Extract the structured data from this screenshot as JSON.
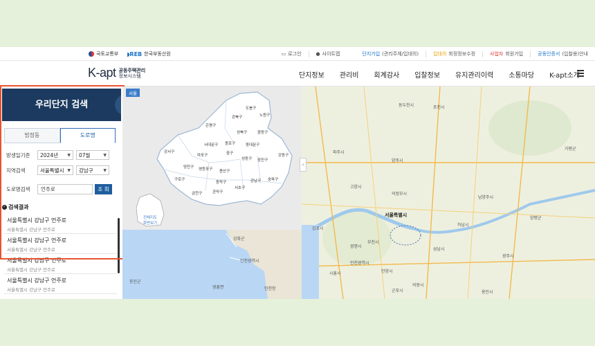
{
  "util_bar": {
    "org1": "국토교통부",
    "org2": "한국부동산원",
    "login": "로그인",
    "sitemap": "사이트맵",
    "link_complex_join": "단지가입",
    "link_complex_join_note": "(관리주체/입대의)",
    "link_resident": "입대의",
    "link_resident_note": "회정정보수정",
    "link_business": "사업자",
    "link_business_note": "회원가입",
    "link_cert": "공동인증서",
    "link_cert_note": "(입찰용)안내"
  },
  "nav": {
    "brand_k": "K-apt",
    "brand_sub1": "공동주택관리",
    "brand_sub2": "정보시스템",
    "items": [
      "단지정보",
      "관리비",
      "회계감사",
      "입찰정보",
      "유지관리이력",
      "소통마당",
      "K-apt소개"
    ]
  },
  "panel": {
    "title": "우리단지 검색",
    "tab_legal": "법정동",
    "tab_road": "도로명",
    "label_year": "방생일기준",
    "year": "2024년",
    "month": "07월",
    "label_region": "지역검색",
    "city": "서울특별시",
    "district": "강남구",
    "label_road": "도로명검색",
    "road_value": "언주로",
    "search_btn": "조 회",
    "results_title": "검색결과",
    "results": [
      {
        "addr": "서울특별시 강남구 언주로",
        "sub": "서울특별시 강남구 언주로"
      },
      {
        "addr": "서울특별시 강남구 언주로",
        "sub": "서울특별시 강남구 언주로"
      },
      {
        "addr": "서울특별시 강남구 언주로",
        "sub": "서울특별시 강남구 언주로"
      },
      {
        "addr": "서울특별시 강남구 언주로",
        "sub": "서울특별시 강남구 언주로"
      }
    ]
  },
  "seoul_map": {
    "tag": "서울",
    "districts": [
      "도봉구",
      "노원구",
      "강북구",
      "은평구",
      "성북구",
      "중랑구",
      "종로구",
      "동대문구",
      "서대문구",
      "마포구",
      "중구",
      "성동구",
      "광진구",
      "강동구",
      "강서구",
      "양천구",
      "영등포구",
      "용산구",
      "동작구",
      "서초구",
      "강남구",
      "송파구",
      "구로구",
      "금천구",
      "관악구"
    ],
    "mini_label1": "전체지도",
    "mini_label2": "화면보기"
  },
  "big_map": {
    "labels": [
      "동두천시",
      "포천시",
      "파주시",
      "양주시",
      "의정부시",
      "고양시",
      "남양주시",
      "김포시",
      "서울특별시",
      "하남시",
      "인천광역시",
      "부천시",
      "광명시",
      "시흥시",
      "성남시",
      "광주시",
      "안양시",
      "군포시",
      "의왕시",
      "용인시",
      "양평군",
      "가평군"
    ]
  },
  "sea_map": {
    "labels": [
      "강화군",
      "인천광역시",
      "옹진군",
      "영흥면",
      "인천항"
    ]
  }
}
